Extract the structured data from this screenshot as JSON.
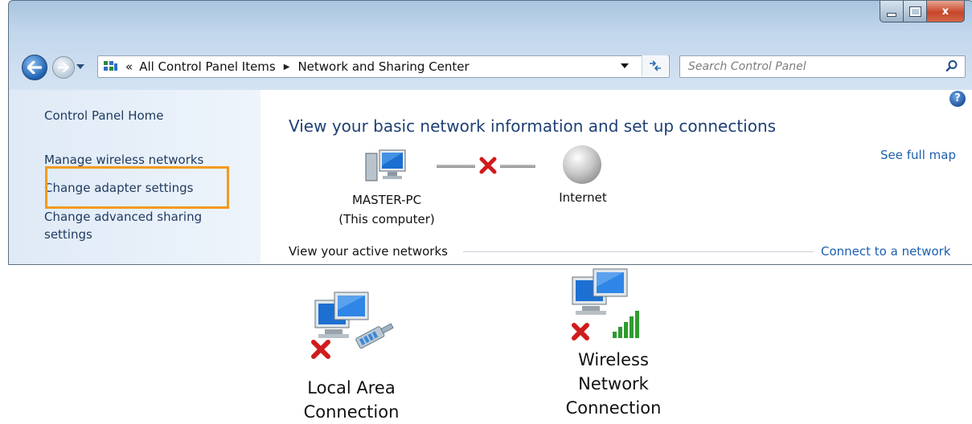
{
  "window": {
    "controls": {
      "minimize": "minimize",
      "maximize": "maximize",
      "close": "x"
    }
  },
  "address_bar": {
    "chevron": "«",
    "crumbs": [
      "All Control Panel Items",
      "Network and Sharing Center"
    ],
    "separator": "▶"
  },
  "search": {
    "placeholder": "Search Control Panel"
  },
  "sidebar": {
    "items": [
      {
        "label": "Control Panel Home"
      },
      {
        "label": "Manage wireless networks"
      },
      {
        "label": "Change adapter settings"
      },
      {
        "label": "Change advanced sharing settings"
      }
    ]
  },
  "content": {
    "heading": "View your basic network information and set up connections",
    "see_full_map": "See full map",
    "computer_name": "MASTER-PC",
    "computer_note": "(This computer)",
    "internet": "Internet",
    "active_networks": "View your active networks",
    "connect_link": "Connect to a network",
    "help": "?"
  },
  "connections": [
    {
      "line1": "Local Area",
      "line2": "Connection"
    },
    {
      "line1": "Wireless",
      "line2": "Network",
      "line3": "Connection"
    }
  ],
  "colors": {
    "link": "#1c5fae",
    "heading": "#1e3f75",
    "highlight": "#f29a22",
    "error_x": "#d01c1c",
    "signal": "#2f9b2f"
  }
}
